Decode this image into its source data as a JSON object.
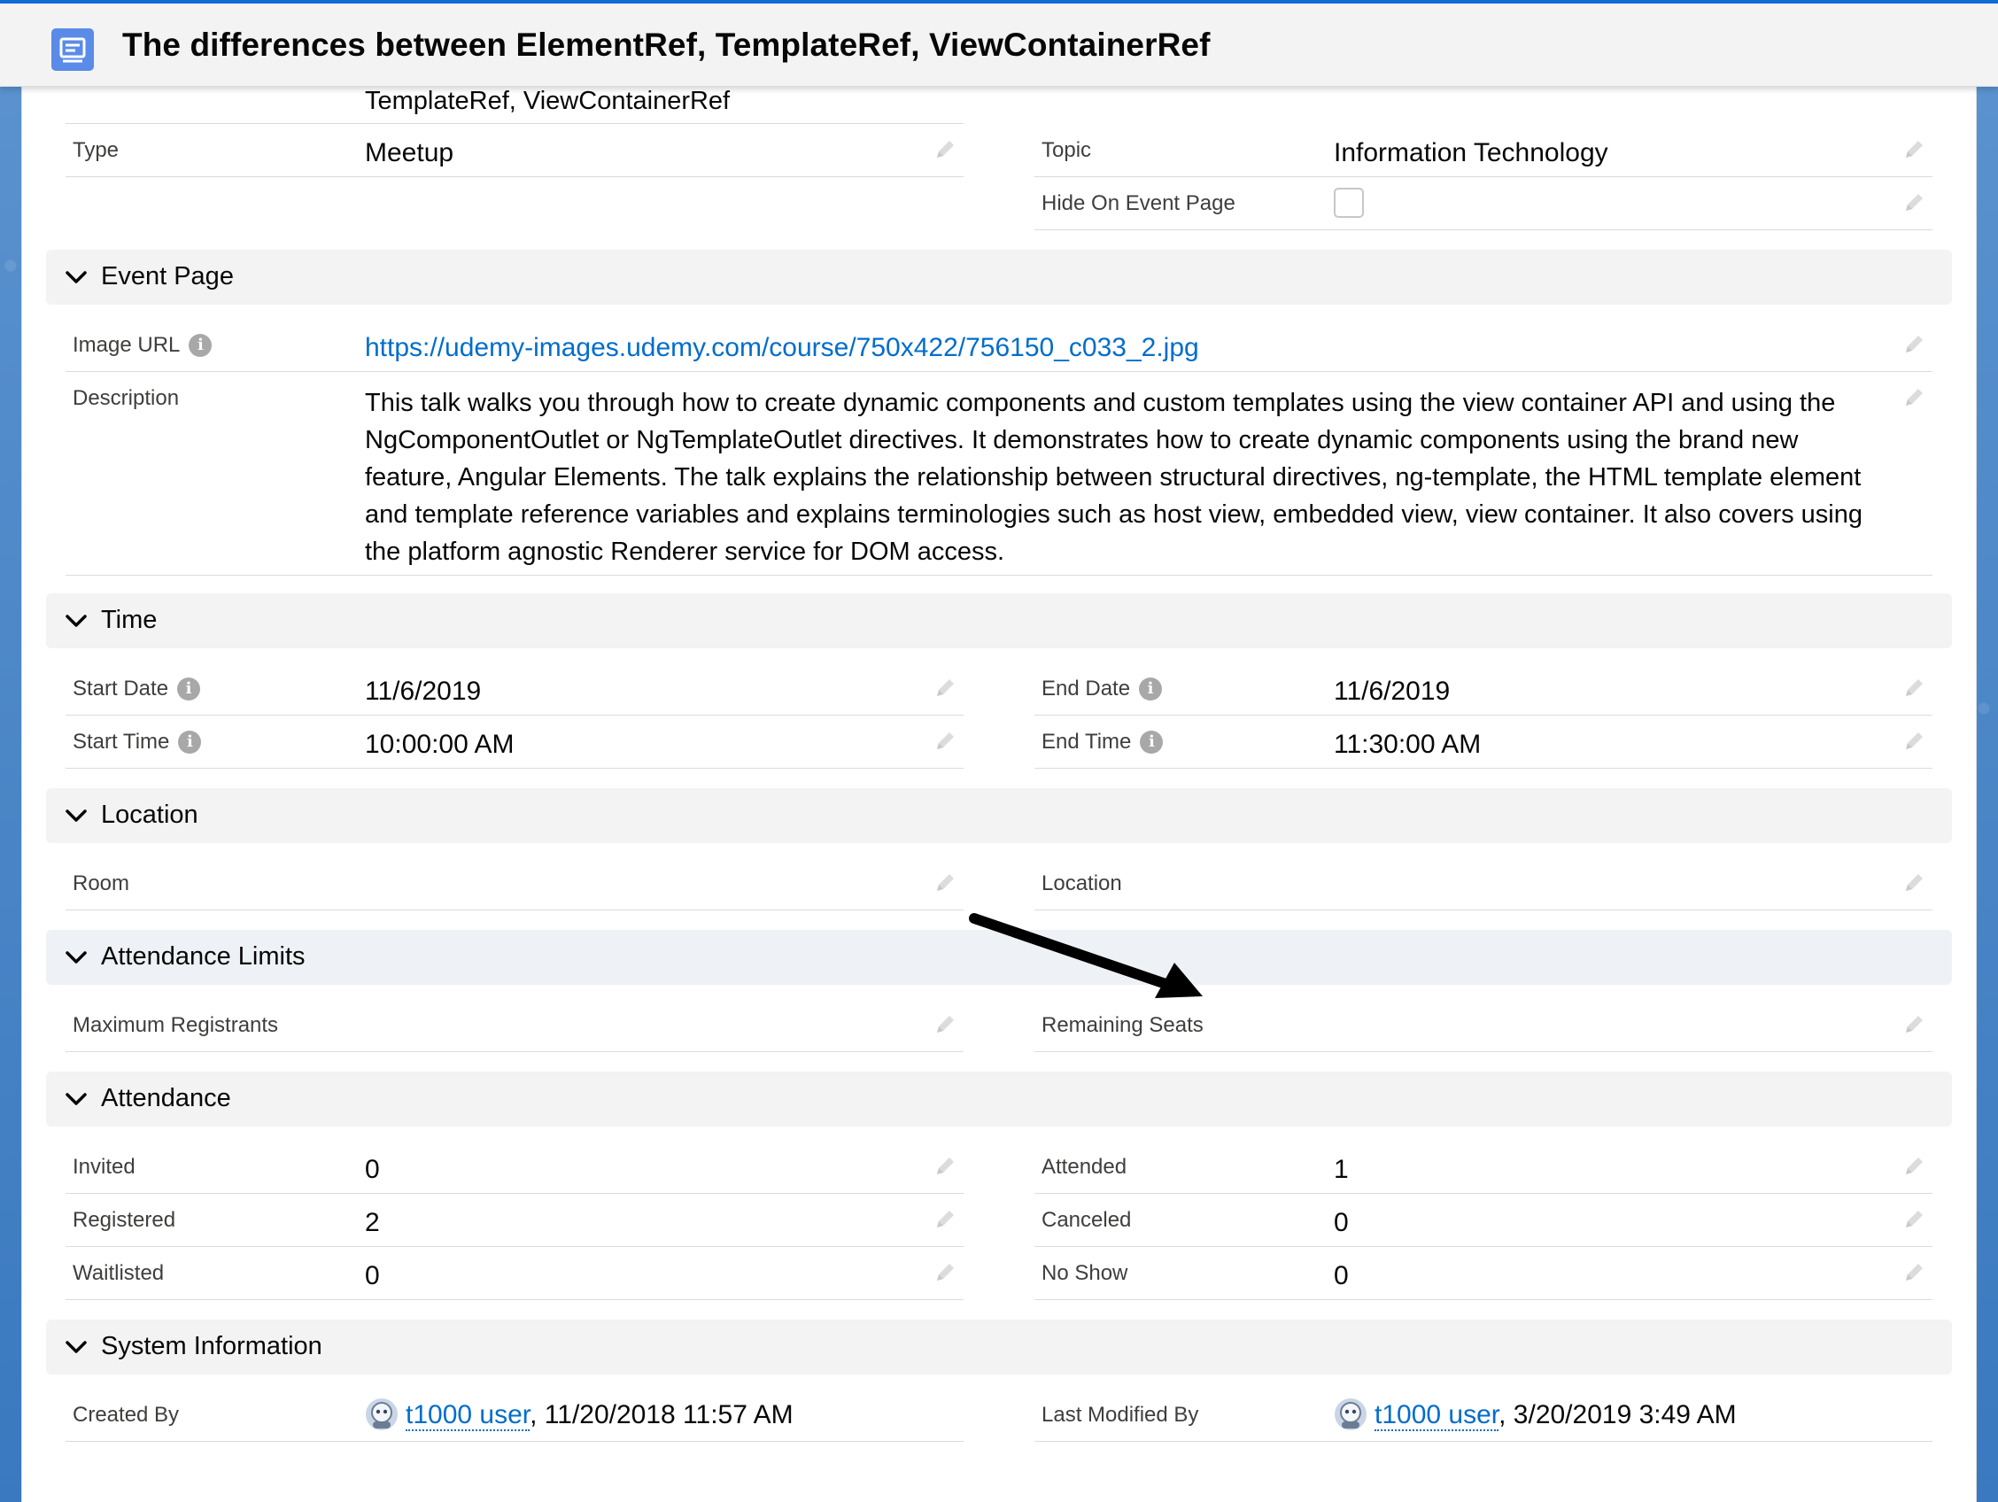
{
  "header": {
    "title": "The differences between ElementRef, TemplateRef, ViewContainerRef"
  },
  "top": {
    "name_value_tail": "TemplateRef, ViewContainerRef",
    "type_label": "Type",
    "type_value": "Meetup",
    "topic_label": "Topic",
    "topic_value": "Information Technology",
    "hide_label": "Hide On Event Page"
  },
  "sections": {
    "event_page": "Event Page",
    "time": "Time",
    "location": "Location",
    "attendance_limits": "Attendance Limits",
    "attendance": "Attendance",
    "system_info": "System Information"
  },
  "event_page": {
    "image_url_label": "Image URL",
    "image_url_value": "https://udemy-images.udemy.com/course/750x422/756150_c033_2.jpg",
    "description_label": "Description",
    "description_value": "This talk walks you through how to create dynamic components and custom templates using the view container API and using the NgComponentOutlet or NgTemplateOutlet directives. It demonstrates how to create dynamic components using the brand new feature, Angular Elements. The talk explains the relationship between structural directives, ng-template, the HTML template element and template reference variables and explains terminologies such as host view, embedded view, view container. It also covers using the platform agnostic Renderer service for DOM access."
  },
  "time": {
    "start_date_label": "Start Date",
    "start_date_value": "11/6/2019",
    "end_date_label": "End Date",
    "end_date_value": "11/6/2019",
    "start_time_label": "Start Time",
    "start_time_value": "10:00:00 AM",
    "end_time_label": "End Time",
    "end_time_value": "11:30:00 AM"
  },
  "location": {
    "room_label": "Room",
    "location_label": "Location"
  },
  "limits": {
    "max_label": "Maximum Registrants",
    "remaining_label": "Remaining Seats"
  },
  "attendance": {
    "invited_label": "Invited",
    "invited_value": "0",
    "attended_label": "Attended",
    "attended_value": "1",
    "registered_label": "Registered",
    "registered_value": "2",
    "canceled_label": "Canceled",
    "canceled_value": "0",
    "waitlisted_label": "Waitlisted",
    "waitlisted_value": "0",
    "noshow_label": "No Show",
    "noshow_value": "0"
  },
  "system": {
    "created_label": "Created By",
    "created_user": "t1000 user",
    "created_date": ", 11/20/2018 11:57 AM",
    "modified_label": "Last Modified By",
    "modified_user": "t1000 user",
    "modified_date": ", 3/20/2019 3:49 AM"
  },
  "icons": {
    "header": "event-record-icon",
    "edit": "pencil-icon",
    "info": "info-icon",
    "chevron": "chevron-down-icon",
    "avatar": "user-avatar-icon",
    "annotation": "arrow-annotation"
  },
  "colors": {
    "accent": "#0f6bd4",
    "link": "#006dcc",
    "section_bg": "#f3f3f3"
  }
}
